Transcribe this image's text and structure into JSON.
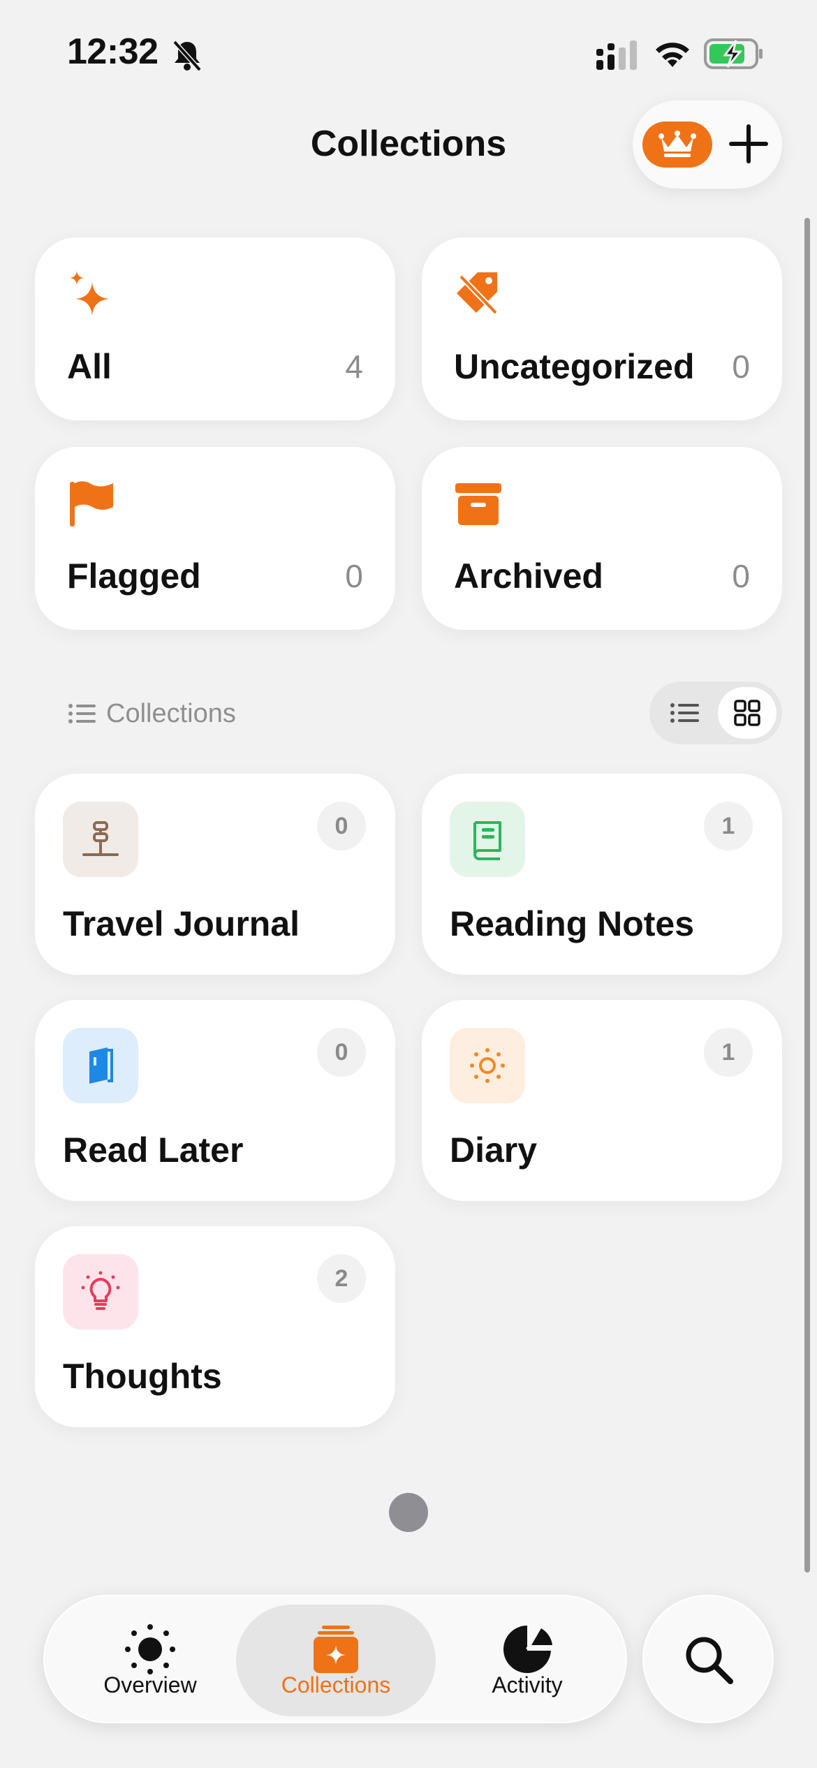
{
  "status_bar": {
    "time": "12:32"
  },
  "header": {
    "title": "Collections"
  },
  "summary": [
    {
      "label": "All",
      "count": "4",
      "icon": "sparkles-icon"
    },
    {
      "label": "Uncategorized",
      "count": "0",
      "icon": "tag-slash-icon"
    },
    {
      "label": "Flagged",
      "count": "0",
      "icon": "flag-icon"
    },
    {
      "label": "Archived",
      "count": "0",
      "icon": "archive-box-icon"
    }
  ],
  "section": {
    "title": "Collections"
  },
  "collections": [
    {
      "label": "Travel Journal",
      "count": "0",
      "icon": "signpost-icon",
      "color": "#8b6a55",
      "bg": "#f0ebe6"
    },
    {
      "label": "Reading Notes",
      "count": "1",
      "icon": "book-icon",
      "color": "#2fb55a",
      "bg": "#e3f5e8"
    },
    {
      "label": "Read Later",
      "count": "0",
      "icon": "booklet-icon",
      "color": "#1e88e5",
      "bg": "#deedfc"
    },
    {
      "label": "Diary",
      "count": "1",
      "icon": "sun-icon",
      "color": "#f08a24",
      "bg": "#fdeee0"
    },
    {
      "label": "Thoughts",
      "count": "2",
      "icon": "lightbulb-icon",
      "color": "#e83a5f",
      "bg": "#fde4ea"
    }
  ],
  "tabs": [
    {
      "label": "Overview",
      "icon": "sun-icon"
    },
    {
      "label": "Collections",
      "icon": "collections-stack-icon",
      "selected": true
    },
    {
      "label": "Activity",
      "icon": "pie-chart-icon"
    }
  ],
  "colors": {
    "accent": "#f07217",
    "background": "#f2f2f2",
    "card": "#ffffff"
  }
}
